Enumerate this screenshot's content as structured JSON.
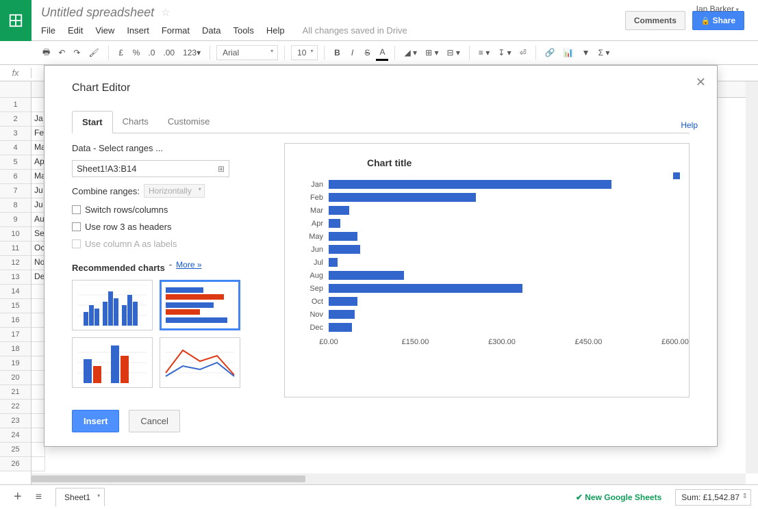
{
  "header": {
    "title": "Untitled spreadsheet",
    "user": "Ian Barker",
    "comments_btn": "Comments",
    "share_btn": "Share",
    "menus": [
      "File",
      "Edit",
      "View",
      "Insert",
      "Format",
      "Data",
      "Tools",
      "Help"
    ],
    "save_msg": "All changes saved in Drive"
  },
  "toolbar": {
    "font": "Arial",
    "size": "10",
    "currency": "£",
    "percent": "%",
    "dec_less": ".0",
    "dec_more": ".00",
    "num_fmt": "123"
  },
  "fx": "fx",
  "sheet": {
    "rows_visible": 26,
    "colA": [
      "",
      "",
      "Jan",
      "Feb",
      "Mar",
      "Apr",
      "May",
      "Jun",
      "Jul",
      "Aug",
      "Sep",
      "Oct",
      "Nov",
      "Dec"
    ]
  },
  "dialog": {
    "title": "Chart Editor",
    "help": "Help",
    "tabs": [
      "Start",
      "Charts",
      "Customise"
    ],
    "active_tab": 0,
    "data_label": "Data - Select ranges ...",
    "range": "Sheet1!A3:B14",
    "combine_label": "Combine ranges:",
    "combine_value": "Horizontally",
    "opt_switch": "Switch rows/columns",
    "opt_row3": "Use row 3 as headers",
    "opt_colA": "Use column A as labels",
    "rec_title": "Recommended charts",
    "rec_more": "More »",
    "insert_btn": "Insert",
    "cancel_btn": "Cancel"
  },
  "chart_data": {
    "type": "bar",
    "title": "Chart title",
    "categories": [
      "Jan",
      "Feb",
      "Mar",
      "Apr",
      "May",
      "Jun",
      "Jul",
      "Aug",
      "Sep",
      "Oct",
      "Nov",
      "Dec"
    ],
    "values": [
      490,
      255,
      35,
      20,
      50,
      55,
      15,
      130,
      335,
      50,
      45,
      40
    ],
    "xlabel": "",
    "ylabel": "",
    "xlim": [
      0,
      600
    ],
    "ticks": [
      "£0.00",
      "£150.00",
      "£300.00",
      "£450.00",
      "£600.00"
    ]
  },
  "footer": {
    "sheet_tab": "Sheet1",
    "new_sheets": "New Google Sheets",
    "sum": "Sum: £1,542.87"
  }
}
